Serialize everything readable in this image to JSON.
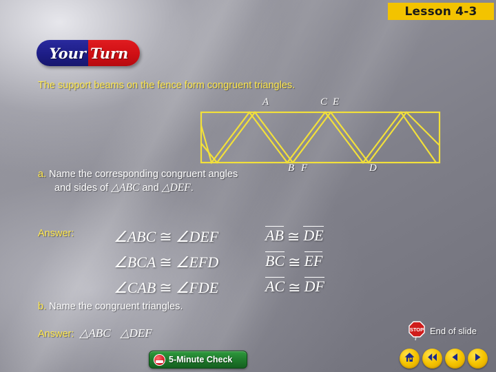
{
  "slide": {
    "lesson_banner": "Lesson 4-3",
    "badge": {
      "word_left": "Your",
      "word_right": "Turn",
      "color_left": "#1d1d86",
      "color_right": "#cf0f14"
    },
    "question": "The support beams on the fence form congruent triangles.",
    "accent_yellow": "#ffe84d",
    "diagram_line_color": "#f2e03a"
  },
  "part_a": {
    "marker": "a.",
    "line1": "Name the corresponding congruent angles",
    "line2_prefix": "and sides of ",
    "triangle1": "△ABC",
    "line2_mid": " and ",
    "triangle2": "△DEF",
    "line2_suffix": ".",
    "answer_label": "Answer:",
    "angle_congruences": [
      {
        "left": "∠ABC",
        "symbol": "≅",
        "right": "∠DEF"
      },
      {
        "left": "∠BCA",
        "symbol": "≅",
        "right": "∠EFD"
      },
      {
        "left": "∠CAB",
        "symbol": "≅",
        "right": "∠FDE"
      }
    ],
    "side_congruences": [
      {
        "left": "AB",
        "symbol": "≅",
        "right": "DE"
      },
      {
        "left": "BC",
        "symbol": "≅",
        "right": "EF"
      },
      {
        "left": "AC",
        "symbol": "≅",
        "right": "DF"
      }
    ]
  },
  "part_b": {
    "marker": "b.",
    "text": "Name the congruent triangles.",
    "answer_label": "Answer:",
    "triangle1": "△ABC",
    "triangle2": "△DEF"
  },
  "diagram": {
    "labels": [
      {
        "name": "A",
        "text": "A"
      },
      {
        "name": "C",
        "text": "C"
      },
      {
        "name": "E",
        "text": "E"
      },
      {
        "name": "B",
        "text": "B"
      },
      {
        "name": "F",
        "text": "F"
      },
      {
        "name": "D",
        "text": "D"
      }
    ]
  },
  "footer": {
    "end_of_slide": "End of slide",
    "five_minute_check": "5-Minute Check",
    "nav": [
      {
        "name": "home",
        "glyph": "home"
      },
      {
        "name": "rewind",
        "glyph": "double-left"
      },
      {
        "name": "previous",
        "glyph": "left"
      },
      {
        "name": "next",
        "glyph": "right"
      }
    ]
  }
}
